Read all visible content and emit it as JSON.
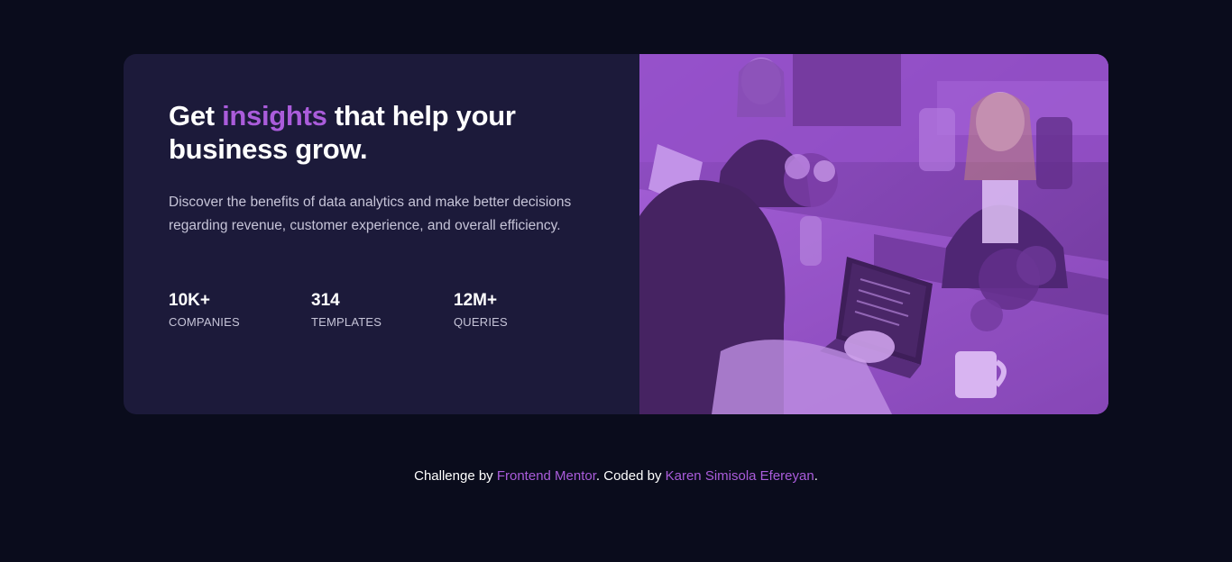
{
  "hero": {
    "title_before": "Get ",
    "title_accent": "insights",
    "title_after": " that help your business grow.",
    "description": "Discover the benefits of data analytics and make better decisions regarding revenue, customer experience, and overall efficiency."
  },
  "stats": [
    {
      "value": "10K+",
      "label": "COMPANIES"
    },
    {
      "value": "314",
      "label": "TEMPLATES"
    },
    {
      "value": "12M+",
      "label": "QUERIES"
    }
  ],
  "footer": {
    "prefix": "Challenge by ",
    "link1": "Frontend Mentor",
    "middle": ". Coded by ",
    "link2": "Karen Simisola Efereyan",
    "suffix": "."
  },
  "colors": {
    "background": "#0a0c1c",
    "card": "#1c1a3a",
    "accent": "#aa5cdb",
    "text_muted": "#c6c4d8"
  },
  "image": {
    "subject": "people-working-at-table-photo"
  }
}
